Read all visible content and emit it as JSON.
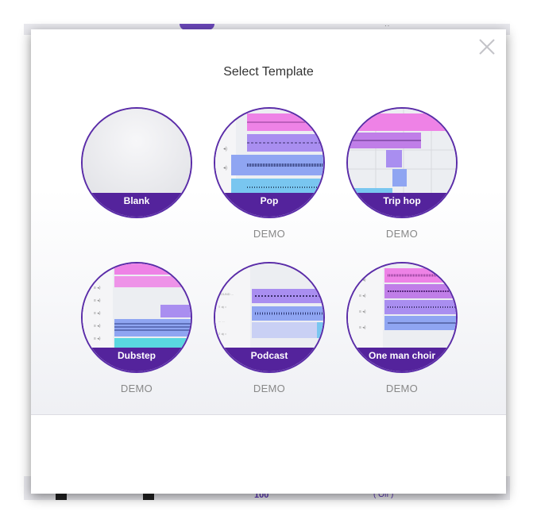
{
  "modal": {
    "title": "Select Template",
    "close_icon": "close-icon"
  },
  "templates": [
    {
      "label": "Blank",
      "demo": ""
    },
    {
      "label": "Pop",
      "demo": "DEMO"
    },
    {
      "label": "Trip hop",
      "demo": "DEMO"
    },
    {
      "label": "Dubstep",
      "demo": "DEMO"
    },
    {
      "label": "Podcast",
      "demo": "DEMO"
    },
    {
      "label": "One man choir",
      "demo": "DEMO"
    }
  ],
  "background": {
    "tempo": "100",
    "loop_state": "( Off )"
  },
  "colors": {
    "accent": "#54239c",
    "ring": "#5a2ca8",
    "track_pink": "#ee82e6",
    "track_violet": "#a98ef0",
    "track_blue": "#8fa5f2",
    "track_cyan": "#5ad7e0"
  }
}
